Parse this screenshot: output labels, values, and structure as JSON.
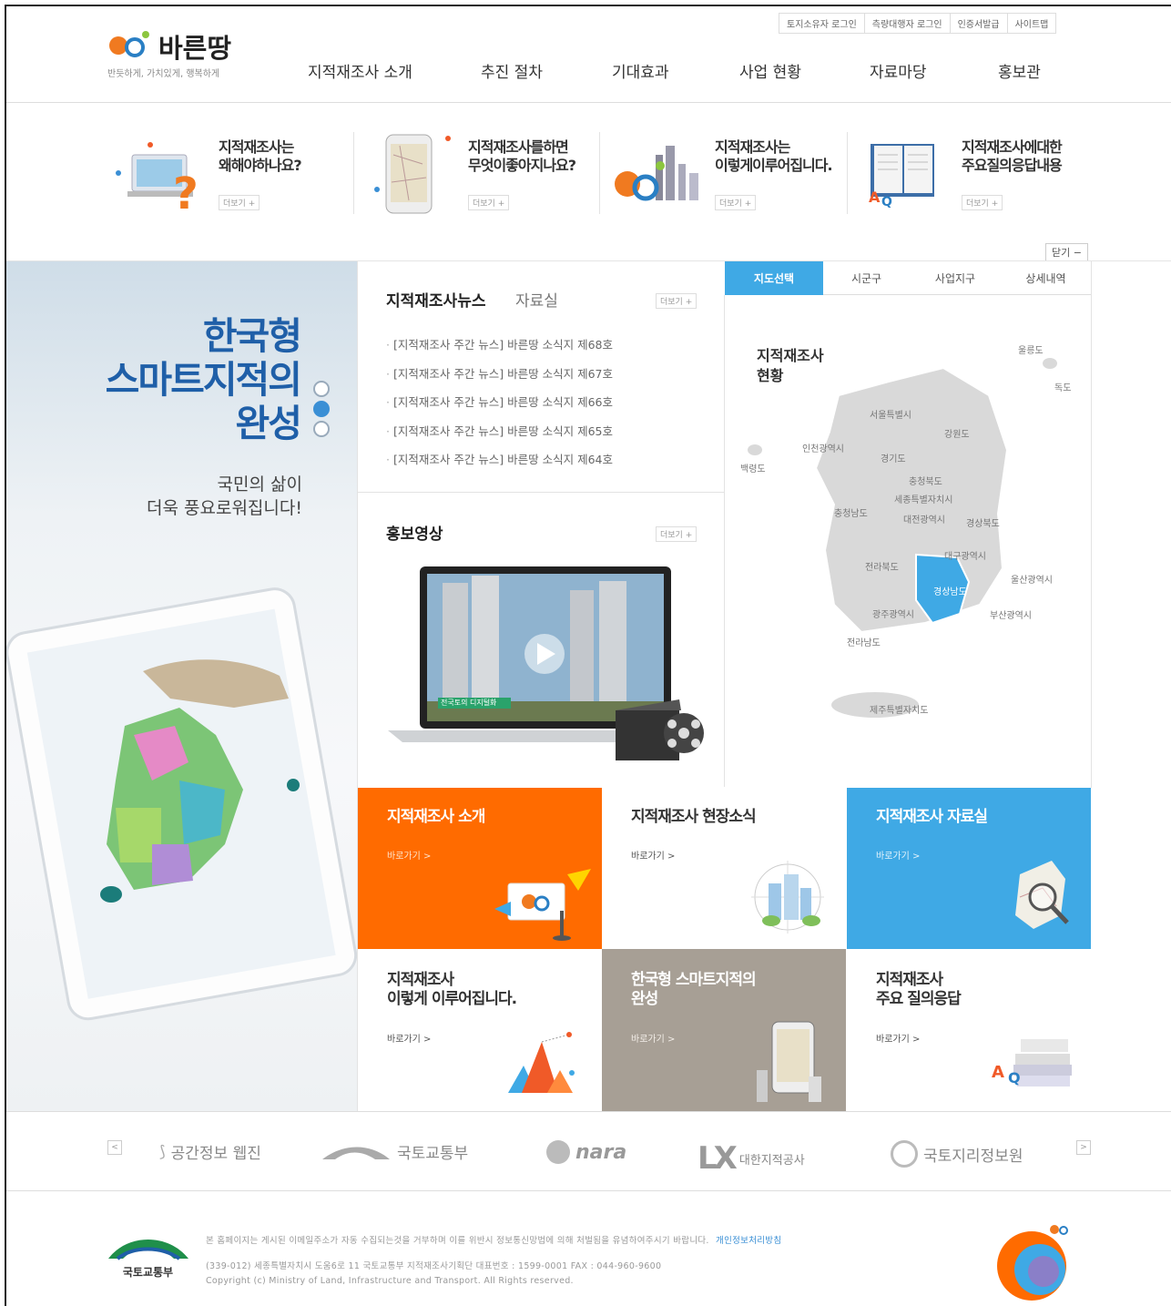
{
  "header": {
    "logo_text": "바른땅",
    "logo_sub": "반듯하게, 가치있게, 행복하게",
    "util_links": [
      "토지소유자 로그인",
      "측량대행자 로그인",
      "인증서발급",
      "사이트맵"
    ],
    "gnb": [
      "지적재조사 소개",
      "추진 절차",
      "기대효과",
      "사업 현황",
      "자료마당",
      "홍보관"
    ]
  },
  "quick": [
    {
      "title": "지적재조사는\n왜해야하나요?",
      "more": "더보기 +"
    },
    {
      "title": "지적재조사를하면\n무엇이좋아지나요?",
      "more": "더보기 +"
    },
    {
      "title": "지적재조사는\n이렇게이루어집니다.",
      "more": "더보기 +"
    },
    {
      "title": "지적재조사에대한\n주요질의응답내용",
      "more": "더보기 +"
    }
  ],
  "close_label": "닫기 −",
  "hero": {
    "title": "한국형\n스마트지적의\n완성",
    "sub": "국민의 삶이\n더욱 풍요로워집니다!"
  },
  "news": {
    "tabs": [
      "지적재조사뉴스",
      "자료실"
    ],
    "more": "더보기 +",
    "items": [
      "[지적재조사 주간 뉴스] 바른땅 소식지 제68호",
      "[지적재조사 주간 뉴스] 바른땅 소식지 제67호",
      "[지적재조사 주간 뉴스] 바른땅 소식지 제66호",
      "[지적재조사 주간 뉴스] 바른땅 소식지 제65호",
      "[지적재조사 주간 뉴스] 바른땅 소식지 제64호"
    ]
  },
  "video": {
    "title": "홍보영상",
    "more": "더보기 +",
    "caption": "전국토의 디지털화"
  },
  "map": {
    "tabs": [
      "지도선택",
      "시군구",
      "사업지구",
      "상세내역"
    ],
    "title": "지적재조사\n현황",
    "regions": [
      "울릉도",
      "독도",
      "서울특별시",
      "강원도",
      "인천광역시",
      "경기도",
      "백령도",
      "충청북도",
      "세종특별자치시",
      "충청남도",
      "대전광역시",
      "경상북도",
      "대구광역시",
      "전라북도",
      "울산광역시",
      "경상남도",
      "광주광역시",
      "부산광역시",
      "전라남도",
      "제주특별자치도"
    ]
  },
  "tiles": [
    {
      "title": "지적재조사 소개",
      "go": "바로가기 >"
    },
    {
      "title": "지적재조사 현장소식",
      "go": "바로가기 >"
    },
    {
      "title": "지적재조사 자료실",
      "go": "바로가기 >"
    },
    {
      "title": "지적재조사\n이렇게 이루어집니다.",
      "go": "바로가기 >"
    },
    {
      "title": "한국형 스마트지적의\n완성",
      "go": "바로가기 >"
    },
    {
      "title": "지적재조사\n주요 질의응답",
      "go": "바로가기 >"
    }
  ],
  "partners": [
    "공간정보 웹진",
    "국토교통부",
    "nara",
    "대한지적공사",
    "국토지리정보원"
  ],
  "partner_arrows": {
    "prev": "<",
    "next": ">"
  },
  "footer": {
    "ministry": "국토교통부",
    "notice": "본 홈페이지는 게시된 이메일주소가 자동 수집되는것을 거부하며 이를 위반시 정보통신망법에 의해 처벌됨을 유념하여주시기 바랍니다.",
    "policy_link": "개인정보처리방침",
    "address": "(339-012) 세종특별자치시 도움6로 11 국토교통부 지적재조사기획단 대표번호 : 1599-0001 FAX : 044-960-9600",
    "copyright": "Copyright (c) Ministry of Land, Infrastructure and Transport. All Rights reserved."
  },
  "colors": {
    "orange": "#ff6b00",
    "blue": "#3fa9e5",
    "gray_tile": "#a79f95",
    "nav_blue": "#1f5fa8"
  }
}
